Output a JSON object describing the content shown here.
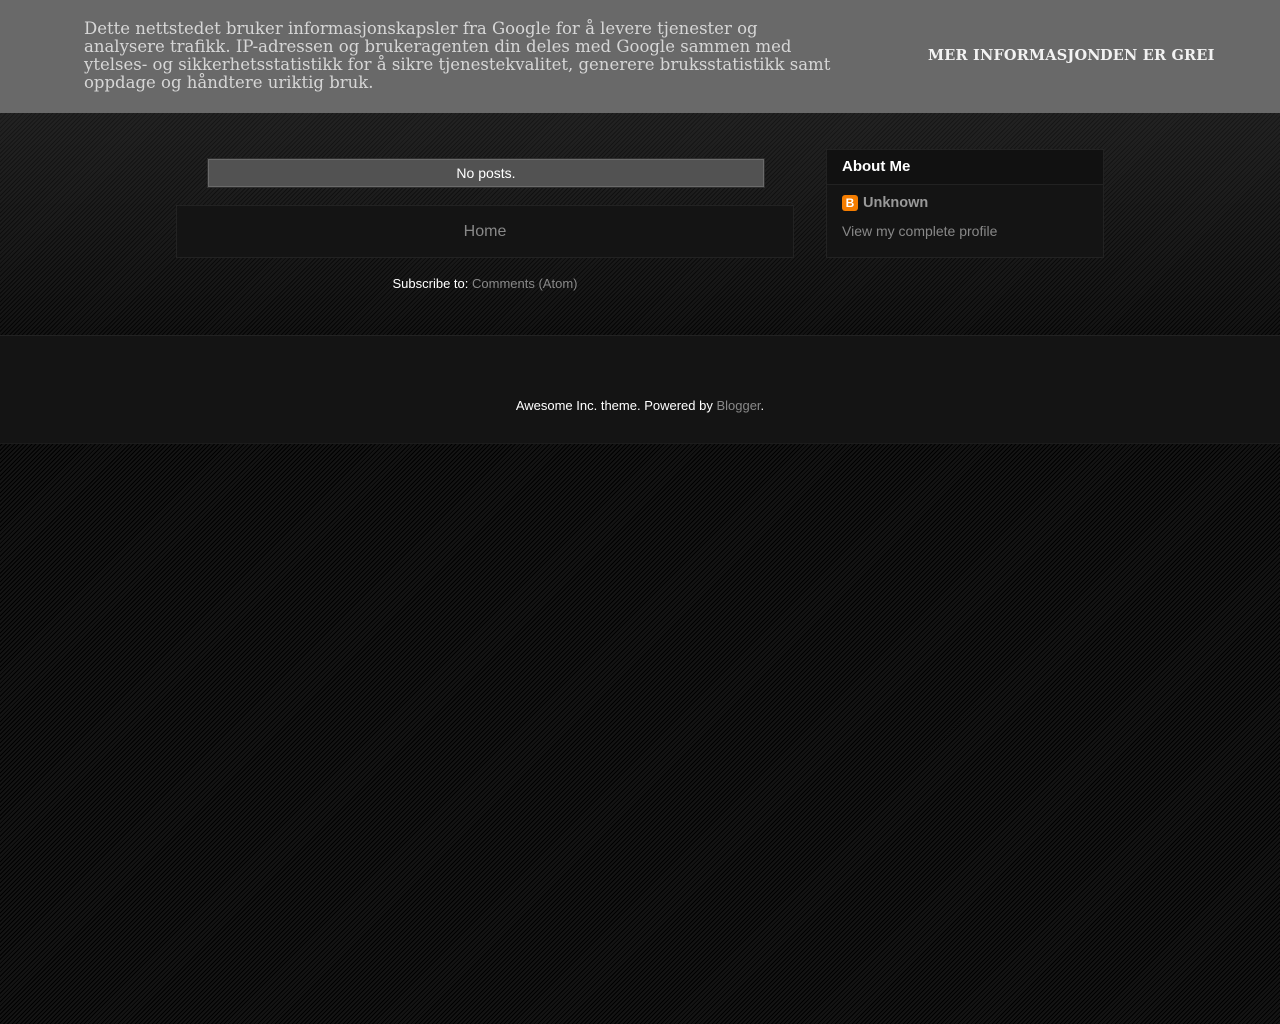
{
  "cookie_notice": {
    "text": "Dette nettstedet bruker informasjonskapsler fra Google for å levere tjenester og analysere trafikk. IP-adressen og brukeragenten din deles med Google sammen med ytelses- og sikkerhetsstatistikk for å sikre tjenestekvalitet, generere bruksstatistikk samt oppdage og håndtere uriktig bruk.",
    "more_info_label": "Mer informasjon",
    "ok_label": "Den er grei"
  },
  "main": {
    "status_message": "No posts.",
    "pager_home_label": "Home",
    "subscribe_prefix": "Subscribe to: ",
    "subscribe_link": "Comments (Atom)"
  },
  "sidebar": {
    "about_title": "About Me",
    "profile_icon": "blogger-icon",
    "profile_icon_glyph": "B",
    "profile_name": "Unknown",
    "profile_link": "View my complete profile"
  },
  "footer": {
    "attribution_prefix": "Awesome Inc. theme. Powered by ",
    "attribution_link": "Blogger",
    "attribution_suffix": "."
  },
  "colors": {
    "cookie_bar": "#696969",
    "link": "#888888",
    "blogger_orange": "#f57d00",
    "panel": "#141414"
  }
}
